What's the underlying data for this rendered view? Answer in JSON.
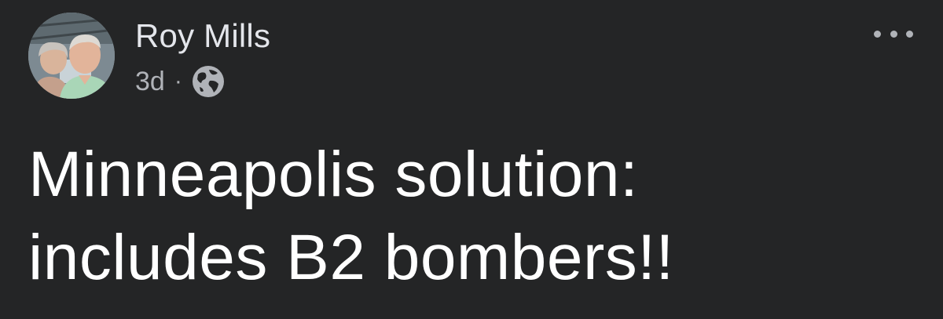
{
  "post": {
    "author": "Roy Mills",
    "timestamp": "3d",
    "separator": "·",
    "audience_icon": "globe-icon",
    "menu_icon": "more-dots-icon",
    "text_lines": [
      "Minneapolis solution:",
      "includes B2 bombers!!"
    ]
  },
  "colors": {
    "background": "#242526",
    "primary_text": "#ffffff",
    "secondary_text": "#b0b3b8"
  }
}
